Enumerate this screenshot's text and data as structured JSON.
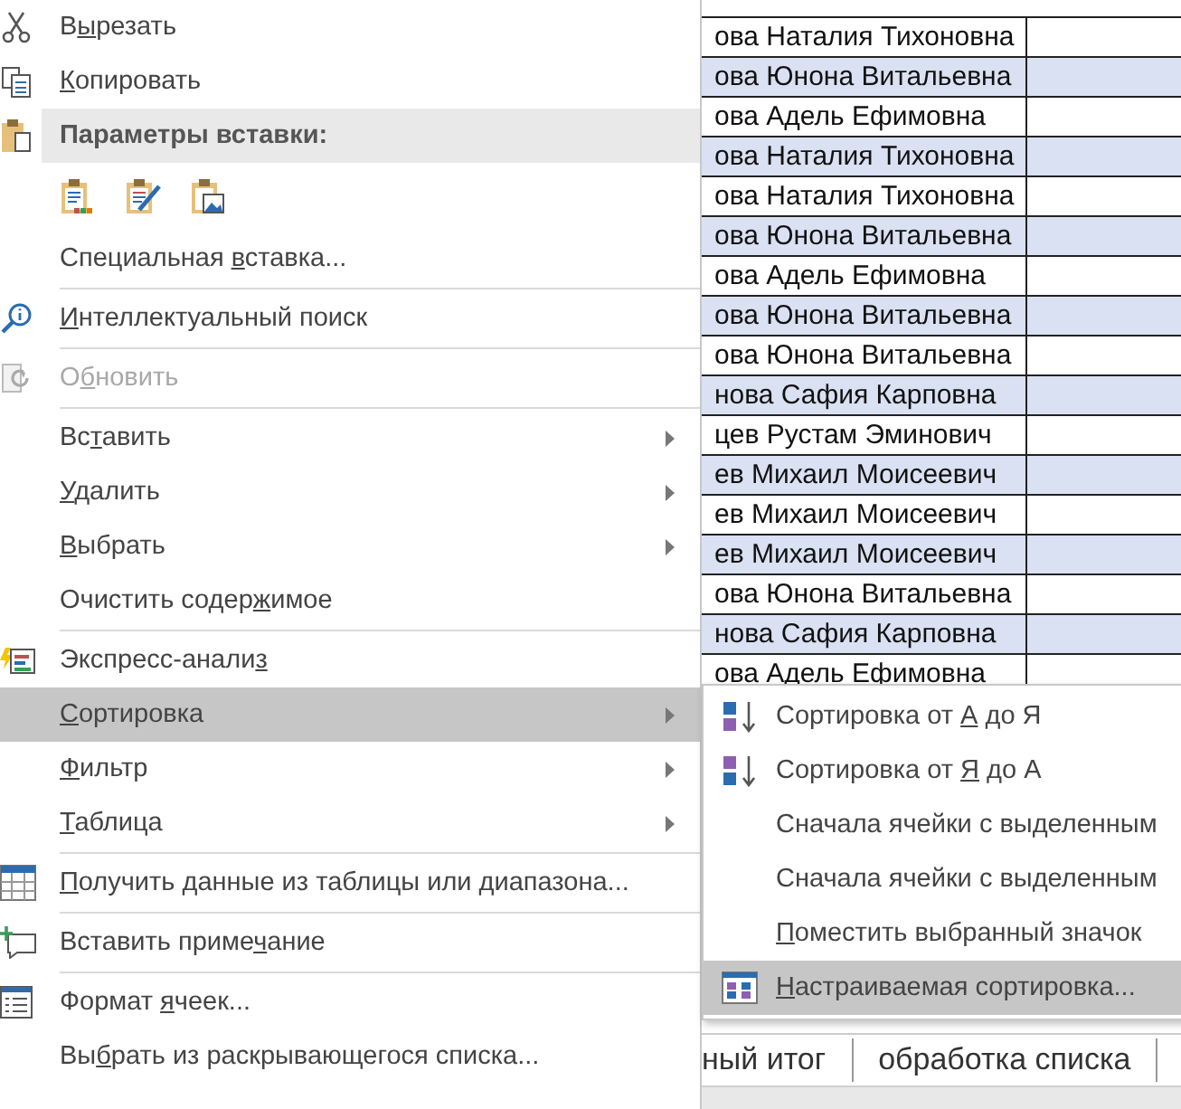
{
  "context_menu": {
    "items": [
      {
        "kind": "command",
        "before": "В",
        "mnemonic": "ы",
        "after": "резать",
        "submenu": false,
        "disabled": false,
        "selected": false
      },
      {
        "kind": "command",
        "mnemonic": "К",
        "after": "опировать",
        "submenu": false,
        "disabled": false,
        "selected": false
      },
      {
        "kind": "header",
        "after": "Параметры вставки:"
      },
      {
        "kind": "paste-options"
      },
      {
        "kind": "command",
        "before": "Специальная ",
        "mnemonic": "в",
        "after": "ставка...",
        "submenu": false,
        "disabled": false,
        "selected": false
      },
      {
        "kind": "separator"
      },
      {
        "kind": "command",
        "mnemonic": "И",
        "after": "нтеллектуальный поиск",
        "submenu": false,
        "disabled": false,
        "selected": false
      },
      {
        "kind": "separator"
      },
      {
        "kind": "command",
        "before": "О",
        "mnemonic": "б",
        "after": "новить",
        "submenu": false,
        "disabled": true,
        "selected": false
      },
      {
        "kind": "separator"
      },
      {
        "kind": "command",
        "before": "Вс",
        "mnemonic": "т",
        "after": "авить",
        "submenu": true,
        "disabled": false,
        "selected": false
      },
      {
        "kind": "command",
        "mnemonic": "У",
        "after": "далить",
        "submenu": true,
        "disabled": false,
        "selected": false
      },
      {
        "kind": "command",
        "mnemonic": "В",
        "after": "ыбрать",
        "submenu": true,
        "disabled": false,
        "selected": false
      },
      {
        "kind": "command",
        "before": "Очистить содер",
        "mnemonic": "ж",
        "after": "имое",
        "submenu": false,
        "disabled": false,
        "selected": false
      },
      {
        "kind": "separator"
      },
      {
        "kind": "command",
        "before": "Экспресс-анали",
        "mnemonic": "з",
        "submenu": false,
        "disabled": false,
        "selected": false
      },
      {
        "kind": "command",
        "mnemonic": "С",
        "after": "ортировка",
        "submenu": true,
        "disabled": false,
        "selected": true
      },
      {
        "kind": "command",
        "mnemonic": "Ф",
        "after": "ильтр",
        "submenu": true,
        "disabled": false,
        "selected": false
      },
      {
        "kind": "command",
        "mnemonic": "Т",
        "after": "аблица",
        "submenu": true,
        "disabled": false,
        "selected": false
      },
      {
        "kind": "separator"
      },
      {
        "kind": "command",
        "mnemonic": "П",
        "after": "олучить данные из таблицы или диапазона...",
        "submenu": false,
        "disabled": false,
        "selected": false
      },
      {
        "kind": "separator"
      },
      {
        "kind": "command",
        "before": "Вставить приме",
        "mnemonic": "ч",
        "after": "ание",
        "submenu": false,
        "disabled": false,
        "selected": false
      },
      {
        "kind": "separator"
      },
      {
        "kind": "command",
        "before": "Формат ",
        "mnemonic": "я",
        "after": "чеек...",
        "submenu": false,
        "disabled": false,
        "selected": false
      },
      {
        "kind": "command",
        "before": "Вы",
        "mnemonic": "б",
        "after": "рать из раскрывающегося списка...",
        "submenu": false,
        "disabled": false,
        "selected": false
      }
    ]
  },
  "submenu": {
    "items": [
      {
        "before": "Сортировка от ",
        "mnemonic": "А",
        "after": " до Я",
        "selected": false
      },
      {
        "before": "Сортировка от ",
        "mnemonic": "Я",
        "after": " до А",
        "selected": false
      },
      {
        "before": "Сначала ячейки с выделенным",
        "selected": false
      },
      {
        "before": "Сначала ячейки с выделенным",
        "selected": false
      },
      {
        "mnemonic": "П",
        "after": "оместить выбранный значок",
        "selected": false
      },
      {
        "mnemonic": "Н",
        "after": "астраиваемая сортировка...",
        "selected": true
      }
    ]
  },
  "sheet": {
    "rows": [
      {
        "column_1": "ова Наталия Тихоновна"
      },
      {
        "column_1": "ова Юнона Витальевна"
      },
      {
        "column_1": "ова Адель Ефимовна"
      },
      {
        "column_1": "ова Наталия Тихоновна"
      },
      {
        "column_1": "ова Наталия Тихоновна"
      },
      {
        "column_1": "ова Юнона Витальевна"
      },
      {
        "column_1": "ова Адель Ефимовна"
      },
      {
        "column_1": "ова Юнона Витальевна"
      },
      {
        "column_1": "ова Юнона Витальевна"
      },
      {
        "column_1": "нова Сафия Карповна"
      },
      {
        "column_1": "цев Рустам Эминович"
      },
      {
        "column_1": "ев Михаил Моисеевич"
      },
      {
        "column_1": "ев Михаил Моисеевич"
      },
      {
        "column_1": "ев Михаил Моисеевич"
      },
      {
        "column_1": "ова Юнона Витальевна"
      },
      {
        "column_1": "нова Сафия Карповна"
      },
      {
        "column_1": "ова Адель Ефимовна"
      }
    ],
    "sheet_tabs": [
      "ный итог",
      "обработка списка"
    ]
  }
}
